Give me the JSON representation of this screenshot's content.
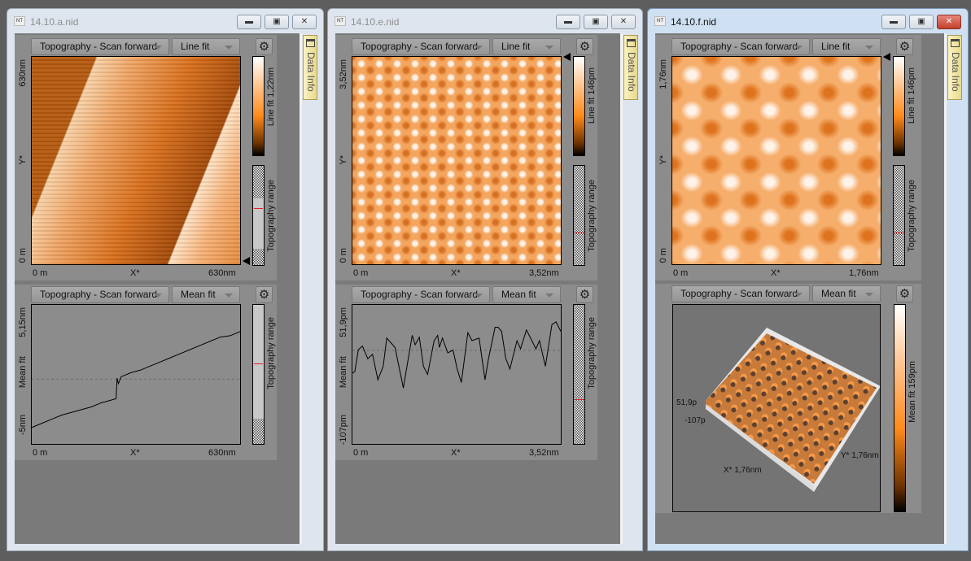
{
  "windows": [
    {
      "title": "14.10.a.nid",
      "active": false,
      "top": {
        "channel": "Topography - Scan forward",
        "filter": "Line fit",
        "y_max": "630nm",
        "y_axis": "Y*",
        "y_min": "0 m",
        "x_min": "0 m",
        "x_axis": "X*",
        "x_max": "630nm",
        "colorbar_label": "Line fit 1,22nm",
        "range_label": "Topography range"
      },
      "bottom": {
        "channel": "Topography - Scan forward",
        "filter": "Mean fit",
        "y_max": "5,15nm",
        "y_axis": "Mean fit",
        "y_min": "-5nm",
        "x_min": "0 m",
        "x_axis": "X*",
        "x_max": "630nm",
        "range_label": "Topography range"
      }
    },
    {
      "title": "14.10.e.nid",
      "active": false,
      "top": {
        "channel": "Topography - Scan forward",
        "filter": "Line fit",
        "y_max": "3,52nm",
        "y_axis": "Y*",
        "y_min": "0 m",
        "x_min": "0 m",
        "x_axis": "X*",
        "x_max": "3,52nm",
        "colorbar_label": "Line fit 146pm",
        "range_label": "Topography range"
      },
      "bottom": {
        "channel": "Topography - Scan forward",
        "filter": "Mean fit",
        "y_max": "51,9pm",
        "y_axis": "Mean fit",
        "y_min": "-107pm",
        "x_min": "0 m",
        "x_axis": "X*",
        "x_max": "3,52nm",
        "range_label": "Topography range"
      }
    },
    {
      "title": "14.10.f.nid",
      "active": true,
      "top": {
        "channel": "Topography - Scan forward",
        "filter": "Line fit",
        "y_max": "1,76nm",
        "y_axis": "Y*",
        "y_min": "0 m",
        "x_min": "0 m",
        "x_axis": "X*",
        "x_max": "1,76nm",
        "colorbar_label": "Line fit 146pm",
        "range_label": "Topography range"
      },
      "bottom": {
        "channel": "Topography - Scan forward",
        "filter": "Mean fit",
        "z_max": "51,9p",
        "z_min": "-107p",
        "x_label": "X* 1,76nm",
        "y_label": "Y* 1,76nm",
        "colorbar_label": "Mean fit 159pm"
      }
    }
  ],
  "data_info_label": "Data Info",
  "icons": {
    "settings": "gear-icon",
    "minimize": "minimize-icon",
    "maximize": "maximize-icon",
    "close": "close-icon"
  },
  "colors": {
    "colormap": [
      "#ffffff",
      "#ff8a1a",
      "#000000"
    ],
    "close_active": "#c2402c"
  },
  "chart_data": [
    {
      "type": "line",
      "xlabel": "X*",
      "ylabel": "Mean fit",
      "xlim": [
        0,
        630
      ],
      "ylim": [
        -5,
        5.15
      ],
      "x": [
        0,
        30,
        60,
        90,
        120,
        150,
        180,
        210,
        240,
        255,
        258,
        262,
        270,
        300,
        330,
        360,
        390,
        420,
        450,
        480,
        510,
        540,
        570,
        600,
        630
      ],
      "y": [
        -3.8,
        -3.5,
        -3.2,
        -2.9,
        -2.7,
        -2.5,
        -2.3,
        -2.0,
        -1.8,
        -1.7,
        -0.2,
        -0.6,
        -0.1,
        0.2,
        0.4,
        0.7,
        1.0,
        1.3,
        1.6,
        1.9,
        2.2,
        2.5,
        2.8,
        2.9,
        3.2
      ]
    },
    {
      "type": "line",
      "xlabel": "X*",
      "ylabel": "Mean fit",
      "xlim": [
        0,
        3.52
      ],
      "ylim": [
        -107,
        51.9
      ],
      "x": [
        0,
        0.04,
        0.1,
        0.17,
        0.26,
        0.34,
        0.43,
        0.52,
        0.58,
        0.72,
        0.86,
        1.01,
        1.06,
        1.13,
        1.2,
        1.27,
        1.38,
        1.44,
        1.47,
        1.52,
        1.61,
        1.7,
        1.77,
        1.84,
        1.95,
        2.02,
        2.14,
        2.24,
        2.3,
        2.41,
        2.46,
        2.52,
        2.59,
        2.66,
        2.78,
        2.84,
        2.94,
        3.1,
        3.16,
        3.26,
        3.37,
        3.44,
        3.52
      ],
      "y": [
        -26,
        -24.5,
        0.8,
        4.8,
        -9.7,
        -4.5,
        -33.7,
        -18.3,
        14,
        3.2,
        -43,
        17.1,
        6.4,
        14.9,
        -18.3,
        -27.5,
        11,
        17.1,
        3.2,
        14,
        -2.9,
        0.2,
        -21.4,
        -36.8,
        20.2,
        11,
        14,
        -33.7,
        -9.1,
        26.3,
        26.3,
        21.7,
        -9.1,
        -21.4,
        11,
        1.7,
        23.3,
        1.7,
        11,
        -18.3,
        29.4,
        32.5,
        21.7
      ]
    }
  ]
}
